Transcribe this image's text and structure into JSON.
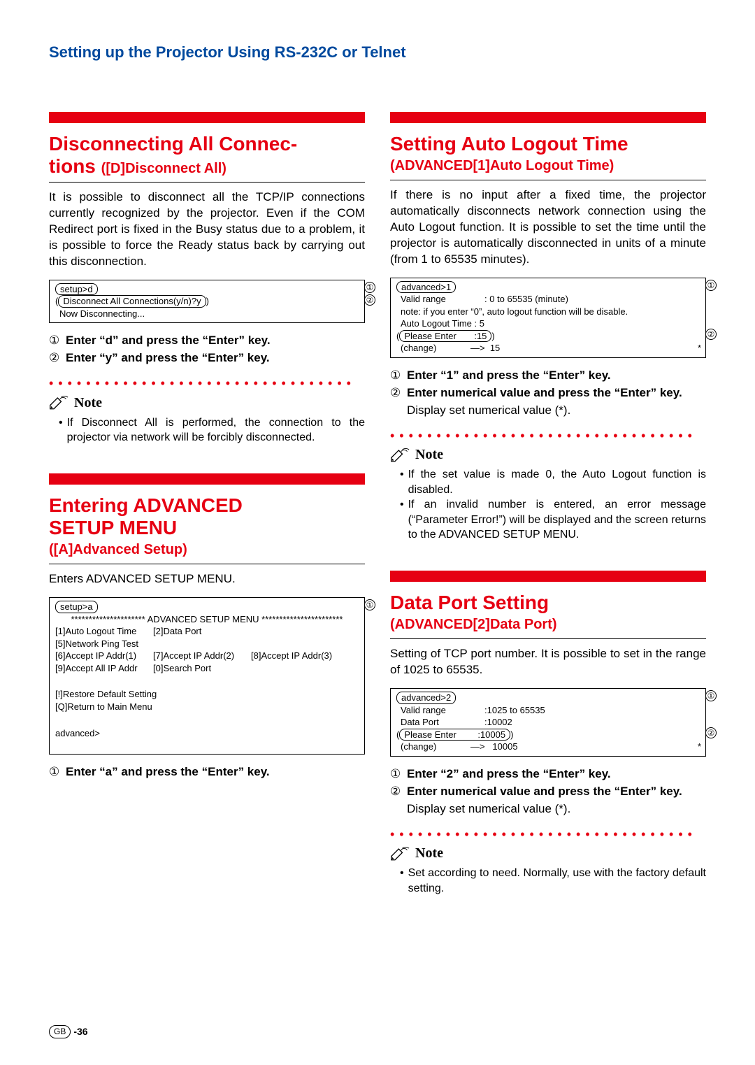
{
  "header": "Setting up the Projector Using RS-232C or Telnet",
  "footer": {
    "gb": "GB",
    "page": "-36"
  },
  "left": {
    "s1": {
      "title": "Disconnecting All Connections",
      "title_sub": "([D]Disconnect All)",
      "body": "It is possible to disconnect all the TCP/IP connections currently recognized by the projector. Even if the COM Redirect port is fixed in the Busy status due to a problem, it is possible to force the Ready status back by carrying out this disconnection.",
      "term": {
        "l1": "setup>d",
        "l2": "Disconnect All Connections(y/n)?y",
        "l3": "Now Disconnecting..."
      },
      "step1": "Enter “d” and press the “Enter” key.",
      "step2": "Enter “y” and press the “Enter” key.",
      "note_label": "Note",
      "note": "If Disconnect All is performed, the connection to the projector via network will be forcibly disconnected."
    },
    "s2": {
      "title_l1": "Entering ADVANCED",
      "title_l2": "SETUP MENU",
      "title_sub": "([A]Advanced Setup)",
      "body": "Enters ADVANCED SETUP MENU.",
      "term": {
        "l1": "setup>a",
        "l2": "********************* ADVANCED SETUP MENU ***********************",
        "l3a": "[1]Auto Logout Time",
        "l3b": "[2]Data Port",
        "l4": "[5]Network Ping Test",
        "l5a": "[6]Accept IP Addr(1)",
        "l5b": "[7]Accept IP Addr(2)",
        "l5c": "[8]Accept IP Addr(3)",
        "l6a": "[9]Accept All IP Addr",
        "l6b": "[0]Search Port",
        "l7": "[!]Restore Default Setting",
        "l8": "[Q]Return to Main Menu",
        "l9": "advanced>"
      },
      "step1": "Enter “a” and press the “Enter” key."
    }
  },
  "right": {
    "s1": {
      "title": "Setting Auto Logout Time",
      "title_sub": "(ADVANCED[1]Auto Logout Time)",
      "body": "If there is no input after a fixed time, the projector automatically disconnects network connection using the Auto Logout function. It is possible to set the time until the projector is automatically disconnected in units of a minute (from 1 to 65535 minutes).",
      "term": {
        "l1": "advanced>1",
        "l2a": "Valid range",
        "l2b": ": 0 to 65535 (minute)",
        "l3": "note: if you enter “0”, auto logout function will be disable.",
        "l4": "Auto Logout Time : 5",
        "l5a": "Please Enter",
        "l5b": ":15",
        "l6a": "(change)",
        "l6b": "—>  15"
      },
      "step1": "Enter “1” and press the “Enter” key.",
      "step2": "Enter numerical value and press the “Enter” key.",
      "step2b": "Display set numerical value (*).",
      "note_label": "Note",
      "note1": "If the set value is made 0, the Auto Logout function is disabled.",
      "note2": "If an invalid number is entered, an error message (“Parameter Error!”) will be displayed and the screen returns to the ADVANCED SETUP MENU."
    },
    "s2": {
      "title": "Data Port Setting",
      "title_sub": "(ADVANCED[2]Data Port)",
      "body": "Setting of TCP port number. It is possible to set in the range of 1025 to 65535.",
      "term": {
        "l1": "advanced>2",
        "l2a": "Valid range",
        "l2b": ":1025 to 65535",
        "l3a": "Data Port",
        "l3b": ":10002",
        "l4a": "Please Enter",
        "l4b": ":10005",
        "l5a": "(change)",
        "l5b": "—>   10005"
      },
      "step1": "Enter “2” and press the “Enter” key.",
      "step2": "Enter numerical value and press the “Enter” key.",
      "step2b": "Display set numerical value (*).",
      "note_label": "Note",
      "note": "Set according to need. Normally, use with the factory default setting."
    }
  },
  "glyph": {
    "c1": "①",
    "c2": "②"
  }
}
